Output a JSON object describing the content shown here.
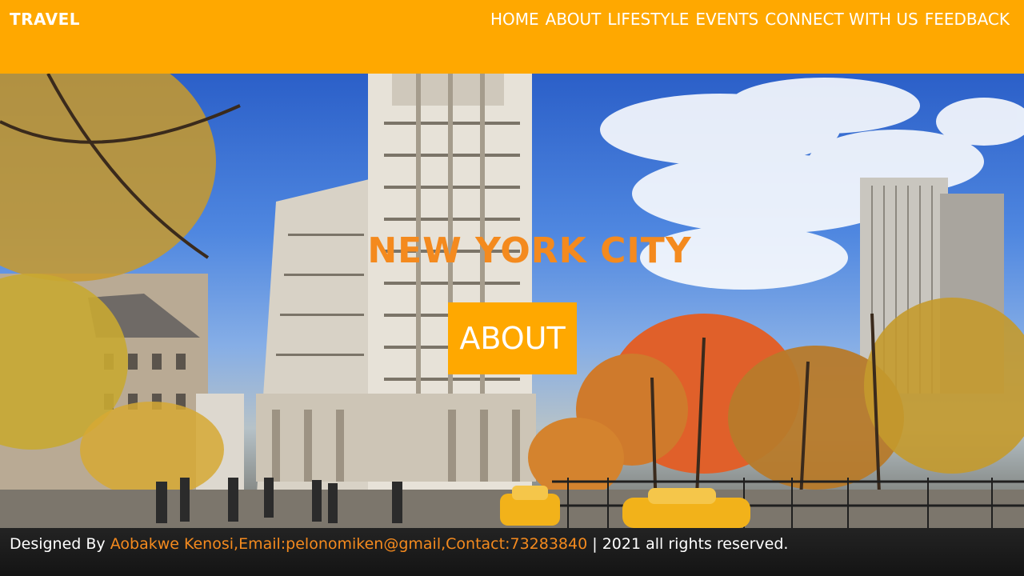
{
  "header": {
    "brand": "TRAVEL",
    "nav": [
      "HOME",
      "ABOUT",
      "LIFESTYLE",
      "EVENTS",
      "CONNECT WITH US",
      "FEEDBACK"
    ]
  },
  "hero": {
    "title": "NEW YORK CITY",
    "button_label": "ABOUT"
  },
  "footer": {
    "prefix": "Designed By",
    "credits": "Aobakwe Kenosi,Email:pelonomiken@gmail,Contact:73283840",
    "separator": "|",
    "rights": "2021 all rights reserved."
  },
  "colors": {
    "header_bg": "#FFA800",
    "accent": "#F48A1E",
    "footer_bg": "#1b1b1b"
  }
}
